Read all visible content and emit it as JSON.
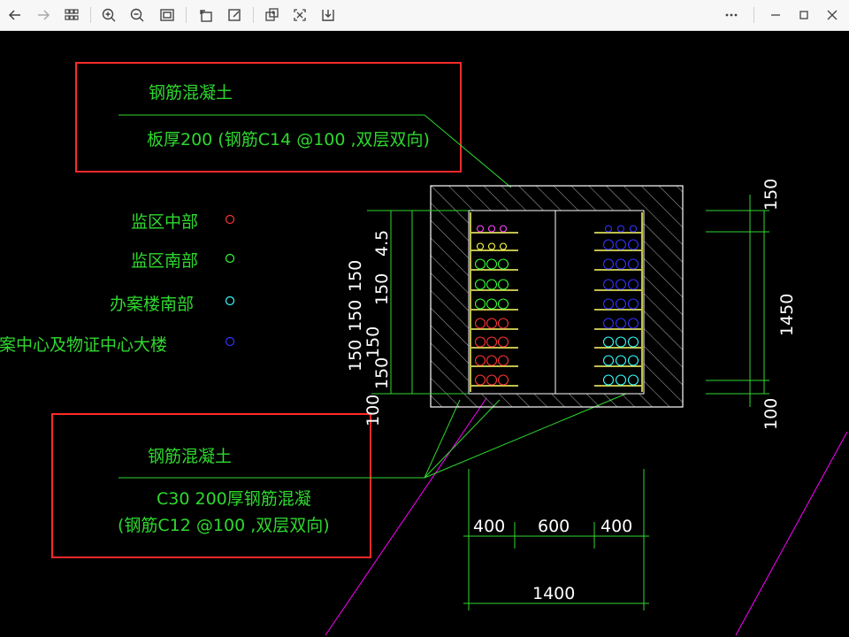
{
  "toolbar": {
    "icons": [
      "back-icon",
      "forward-icon",
      "grid-view-icon",
      "zoom-in-icon",
      "zoom-out-icon",
      "fit-window-icon",
      "rotate-icon",
      "edit-icon",
      "export-icon",
      "fullscreen-icon",
      "download-icon",
      "more-icon",
      "minimize-icon",
      "maximize-icon",
      "close-icon"
    ]
  },
  "drawing": {
    "top_note": {
      "title": "钢筋混凝土",
      "detail": "板厚200 (钢筋C14 @100 ,双层双向)"
    },
    "bottom_note": {
      "title": "钢筋混凝土",
      "line1": "C30  200厚钢筋混凝",
      "line2": "(钢筋C12 @100 ,双层双向)"
    },
    "legend": [
      {
        "label": "监区中部",
        "color": "#ff3333"
      },
      {
        "label": "监区南部",
        "color": "#33ff33"
      },
      {
        "label": "办案楼南部",
        "color": "#33ffff"
      },
      {
        "label": "办案中心及物证中心大楼",
        "color": "#3333ff"
      }
    ],
    "dims_left": [
      "4.5",
      "150",
      "150",
      "150",
      "150",
      "150",
      "150",
      "100"
    ],
    "dims_right": [
      "150",
      "1450",
      "100"
    ],
    "dims_bottom": [
      "400",
      "600",
      "400",
      "1400"
    ]
  }
}
